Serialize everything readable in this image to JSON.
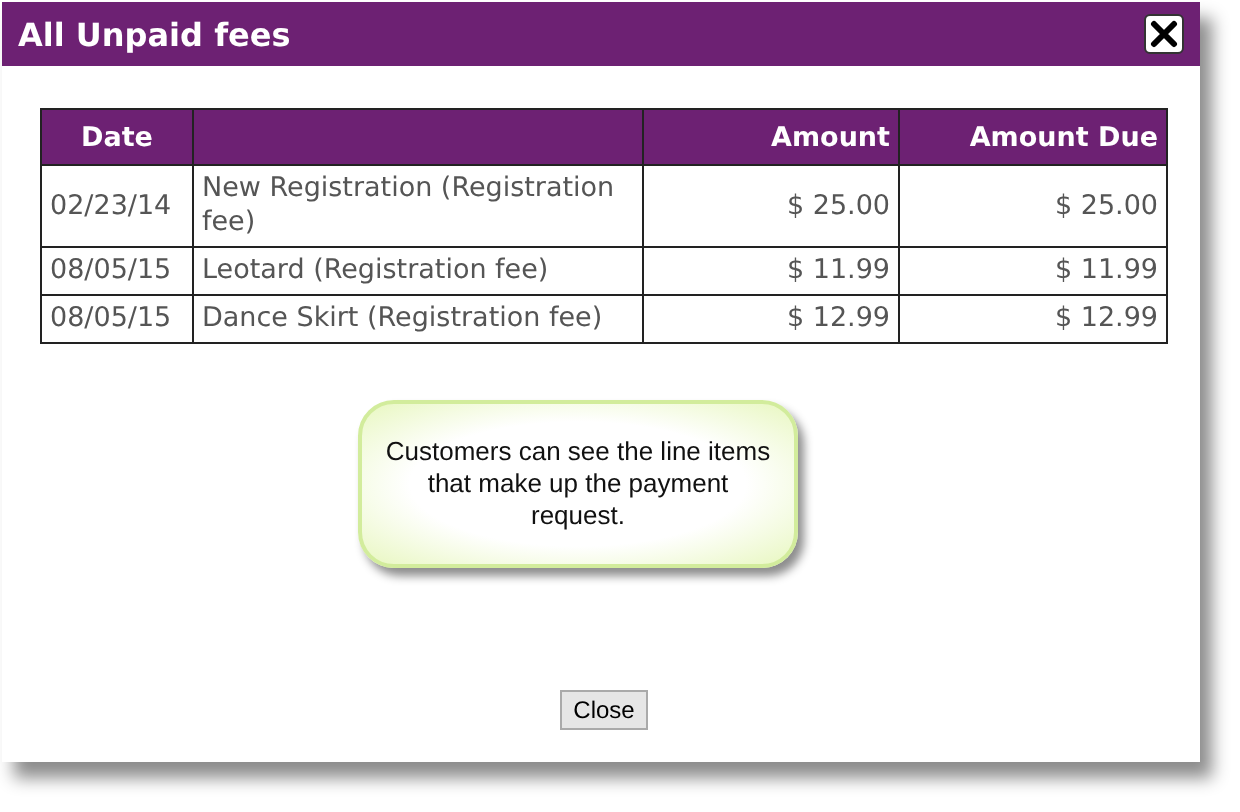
{
  "dialog": {
    "title": "All Unpaid fees"
  },
  "table": {
    "columns": [
      "Date",
      "",
      "Amount",
      "Amount Due"
    ],
    "rows": [
      [
        "02/23/14",
        "New Registration (Registration fee)",
        "$ 25.00",
        "$ 25.00"
      ],
      [
        "08/05/15",
        "Leotard (Registration fee)",
        "$ 11.99",
        "$ 11.99"
      ],
      [
        "08/05/15",
        "Dance Skirt (Registration fee)",
        "$ 12.99",
        "$ 12.99"
      ]
    ]
  },
  "callout": {
    "text": "Customers can see the line items that make up the payment request."
  },
  "buttons": [
    "Close"
  ]
}
